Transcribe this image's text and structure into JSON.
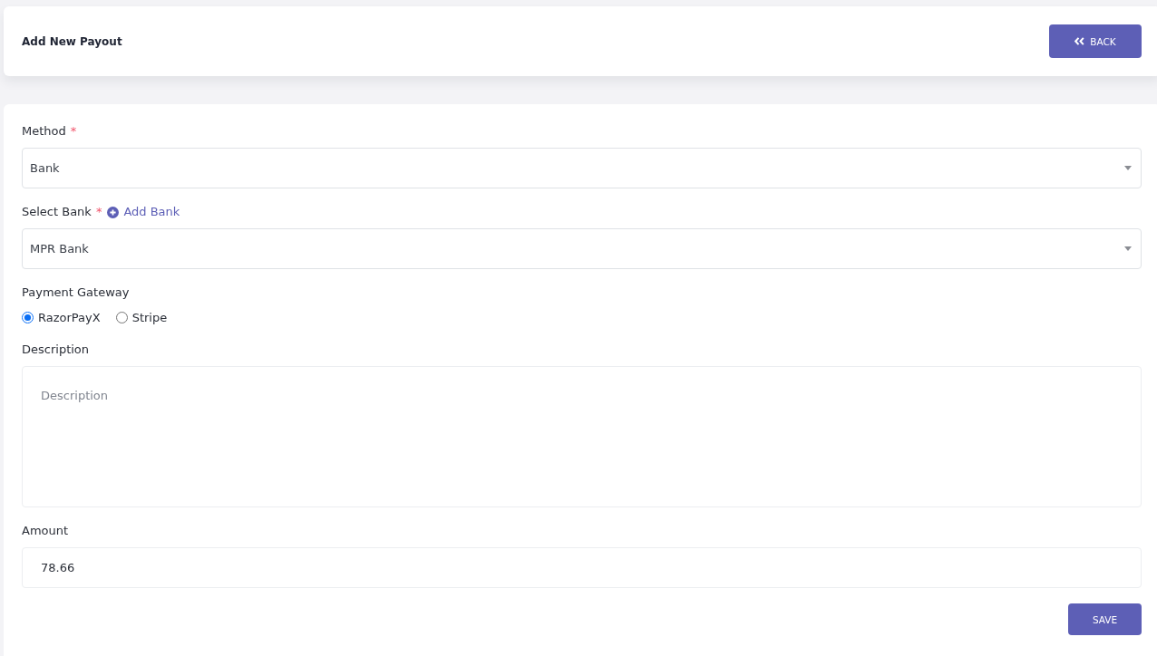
{
  "header": {
    "title": "Add New Payout",
    "back_button": "BACK"
  },
  "form": {
    "fields": [
      {
        "kind": "select",
        "label": "Method",
        "required_mark": "*",
        "value": "Bank"
      },
      {
        "kind": "select",
        "label": "Select Bank",
        "required_mark": "*",
        "link": "Add Bank",
        "value": "MPR Bank"
      },
      {
        "kind": "radio",
        "label": "Payment Gateway",
        "options": [
          {
            "label": "RazorPayX",
            "selected": true
          },
          {
            "label": "Stripe",
            "selected": false
          }
        ]
      },
      {
        "kind": "textarea",
        "label": "Description",
        "placeholder": "Description"
      },
      {
        "kind": "input",
        "label": "Amount",
        "value": "78.66"
      }
    ],
    "save_button": "SAVE"
  }
}
